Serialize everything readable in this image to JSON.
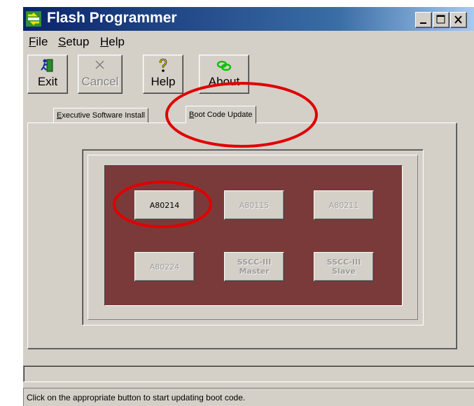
{
  "window": {
    "title": "Flash Programmer"
  },
  "menu": {
    "items": [
      {
        "first": "F",
        "rest": "ile"
      },
      {
        "first": "S",
        "rest": "etup"
      },
      {
        "first": "H",
        "rest": "elp"
      }
    ]
  },
  "toolbar": {
    "exit_label": "Exit",
    "cancel_label": "Cancel",
    "help_label": "Help",
    "about_label": "About"
  },
  "tabs": [
    {
      "first": "E",
      "rest": "xecutive Software Install"
    },
    {
      "first": "B",
      "rest": "oot Code Update"
    }
  ],
  "boot_buttons": [
    {
      "line1": "A80214",
      "line2": "",
      "enabled": true
    },
    {
      "line1": "A80115",
      "line2": "",
      "enabled": false
    },
    {
      "line1": "A80211",
      "line2": "",
      "enabled": false
    },
    {
      "line1": "A80224",
      "line2": "",
      "enabled": false
    },
    {
      "line1": "SSCC-III",
      "line2": "Master",
      "enabled": false
    },
    {
      "line1": "SSCC-III",
      "line2": "Slave",
      "enabled": false
    }
  ],
  "status": {
    "message": "Click on the appropriate button to start updating boot code."
  },
  "colors": {
    "panel": "#7b3a3a",
    "annotation": "#e00000",
    "titlebar": "#0a246a"
  }
}
